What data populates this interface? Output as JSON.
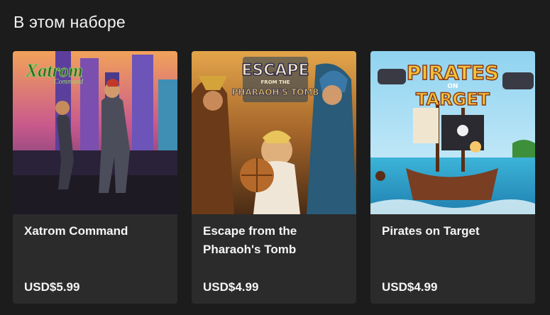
{
  "section": {
    "title": "В этом наборе"
  },
  "games": [
    {
      "name": "Xatrom Command",
      "price": "USD$5.99",
      "art_logo": "Xatrom",
      "art_logo_sub": "Command"
    },
    {
      "name": "Escape from the Pharaoh's Tomb",
      "price": "USD$4.99",
      "art_logo": "ESCAPE",
      "art_logo_mid": "FROM THE",
      "art_logo_sub": "PHARAOH'S TOMB"
    },
    {
      "name": "Pirates on Target",
      "price": "USD$4.99",
      "art_logo": "PIRATES",
      "art_logo_mid": "ON",
      "art_logo_sub": "TARGET"
    }
  ],
  "colors": {
    "background": "#1c1c1c",
    "card": "#2b2b2b",
    "text": "#f5f5f5"
  }
}
